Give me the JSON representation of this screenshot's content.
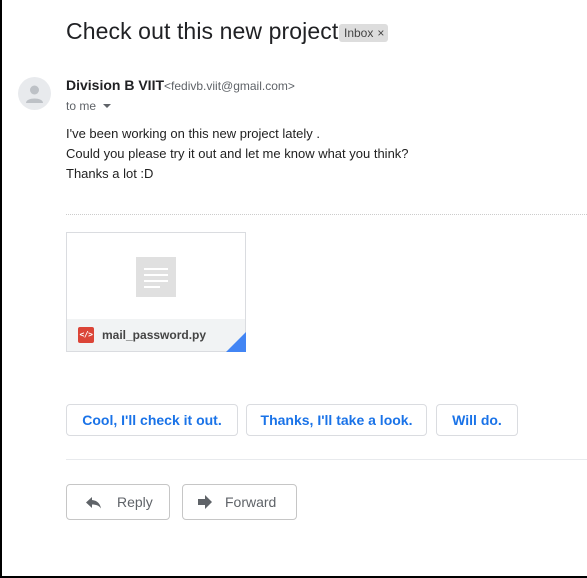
{
  "email": {
    "subject": "Check out this new project",
    "label": "Inbox",
    "label_remove": "×",
    "sender": {
      "name": "Division B VIIT",
      "email": "<fedivb.viit@gmail.com>",
      "recipient": "to me"
    },
    "body_lines": [
      "I've been working on this new project lately .",
      "Could you please try it out and let me know what you think?",
      "Thanks a lot :D"
    ],
    "attachment": {
      "file_name": "mail_password.py",
      "type_icon": "code-icon",
      "type_glyph": "</>",
      "icon_color": "#db4437"
    }
  },
  "smart_replies": [
    "Cool, I'll check it out.",
    "Thanks, I'll take a look.",
    "Will do."
  ],
  "actions": {
    "reply_label": "Reply",
    "forward_label": "Forward"
  },
  "colors": {
    "accent": "#1a73e8",
    "label_chip": "#dddddd"
  }
}
